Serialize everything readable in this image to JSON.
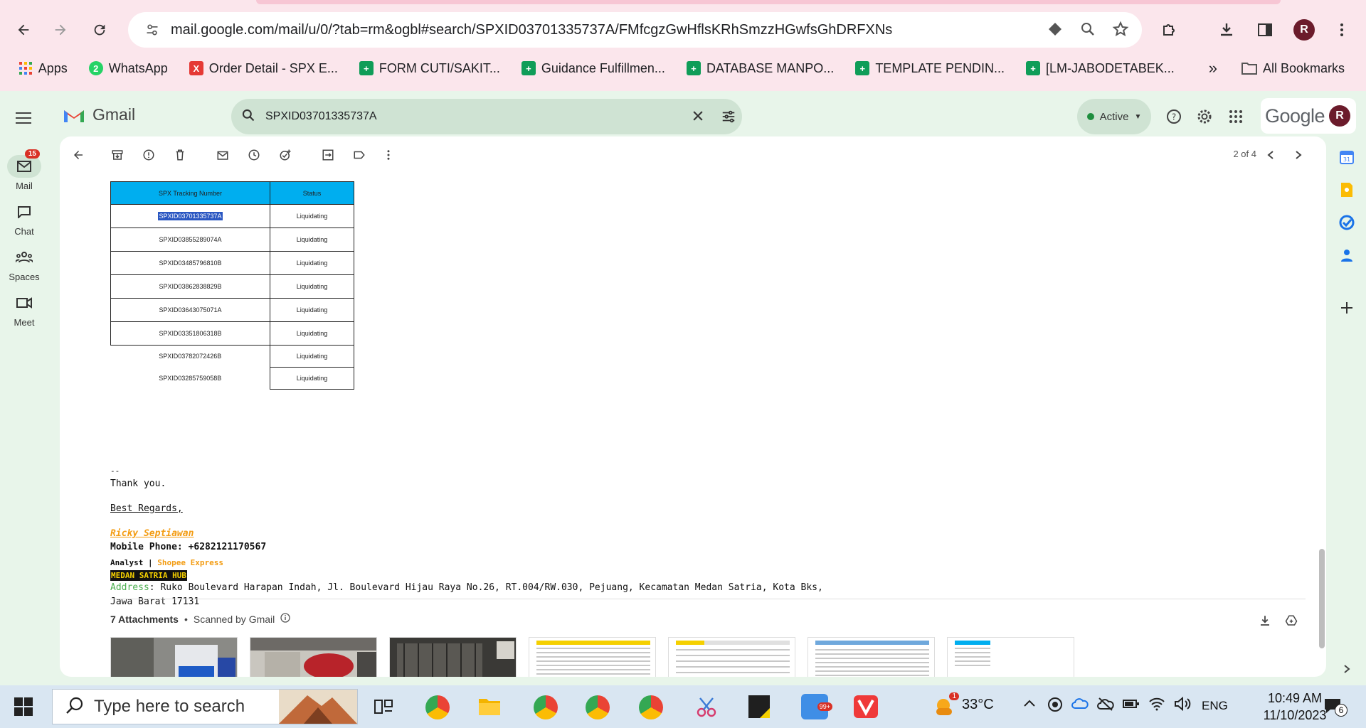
{
  "browser": {
    "url": "mail.google.com/mail/u/0/?tab=rm&ogbl#search/SPXID03701335737A/FMfcgzGwHflsKRhSmzzHGwfsGhDRFXNs",
    "profile_initial": "R",
    "bookmarks": [
      {
        "label": "Apps",
        "icon": "apps-grid-icon",
        "color": "#4285f4"
      },
      {
        "label": "WhatsApp",
        "icon": "whatsapp-icon",
        "color": "#25d366"
      },
      {
        "label": "Order Detail - SPX E...",
        "icon": "x-icon",
        "color": "#e53935"
      },
      {
        "label": "FORM CUTI/SAKIT...",
        "icon": "sheets-icon",
        "color": "#0f9d58"
      },
      {
        "label": "Guidance Fulfillmen...",
        "icon": "sheets-icon",
        "color": "#0f9d58"
      },
      {
        "label": "DATABASE MANPO...",
        "icon": "sheets-icon",
        "color": "#0f9d58"
      },
      {
        "label": "TEMPLATE PENDIN...",
        "icon": "sheets-icon",
        "color": "#0f9d58"
      },
      {
        "label": "[LM-JABODETABEK...",
        "icon": "sheets-icon",
        "color": "#0f9d58"
      }
    ],
    "more_bookmarks": "»",
    "all_bookmarks": "All Bookmarks"
  },
  "gmail": {
    "product_name": "Gmail",
    "search_value": "SPXID03701335737A",
    "status": "Active",
    "google_word": "Google",
    "nav": [
      {
        "label": "Mail",
        "badge": "15"
      },
      {
        "label": "Chat"
      },
      {
        "label": "Spaces"
      },
      {
        "label": "Meet"
      }
    ],
    "pager": "2 of 4"
  },
  "email": {
    "table": {
      "headers": [
        "SPX Tracking Number",
        "Status"
      ],
      "rows": [
        [
          "SPXID03701335737A",
          "Liquidating"
        ],
        [
          "SPXID03855289074A",
          "Liquidating"
        ],
        [
          "SPXID03485796810B",
          "Liquidating"
        ],
        [
          "SPXID03862838829B",
          "Liquidating"
        ],
        [
          "SPXID03643075071A",
          "Liquidating"
        ],
        [
          "SPXID03351806318B",
          "Liquidating"
        ],
        [
          "SPXID03782072426B",
          "Liquidating"
        ],
        [
          "SPXID03285759058B",
          "Liquidating"
        ]
      ]
    },
    "signature": {
      "dashes": "--",
      "thanks": "Thank you.",
      "regards": "Best Regards,",
      "name": "Ricky Septiawan ",
      "phone": "Mobile Phone: +6282121170567",
      "role": "Analyst | ",
      "company": "Shopee Express",
      "hub": "MEDAN SATRIA HUB",
      "address_label": "Address",
      "address_line1": ": Ruko Boulevard Harapan Indah, Jl. Boulevard Hijau Raya No.26, RT.004/RW.030, Pejuang, Kecamatan Medan Satria, Kota Bks,",
      "address_line2": "Jawa Barat 17131"
    },
    "attachments": {
      "title": "7 Attachments",
      "separator": "•",
      "scanned": "Scanned by Gmail"
    }
  },
  "taskbar": {
    "search_placeholder": "Type here to search",
    "weather": "33°C",
    "weather_badge": "1",
    "language": "ENG",
    "time": "10:49 AM",
    "date": "11/10/2023",
    "notifications": "6"
  },
  "colors": {
    "chrome_bg": "#fbe6ec",
    "gmail_bg": "#e8f5ea",
    "table_header": "#00aeef",
    "signature_orange": "#f39c12",
    "address_green": "#4caf50"
  }
}
